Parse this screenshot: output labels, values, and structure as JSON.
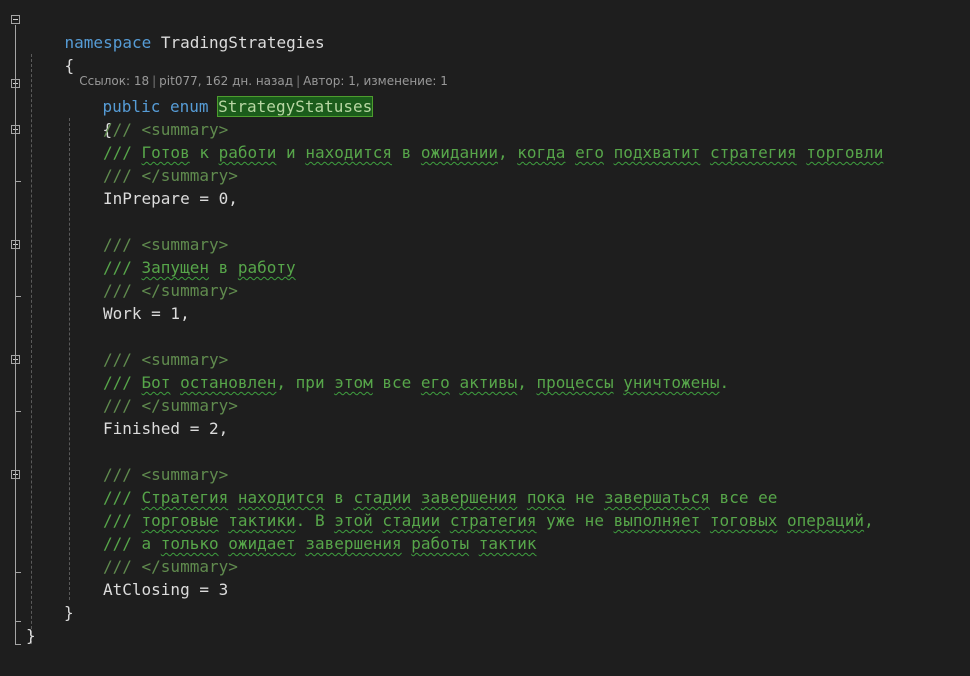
{
  "code": {
    "l1": {
      "kw": "namespace",
      "name": "TradingStrategies"
    },
    "l2": {
      "brace": "{"
    },
    "codelens": {
      "refs": "Ссылок: 18",
      "changed": "pit077, 162 дн. назад",
      "authors": "Автор: 1, изменение: 1"
    },
    "l4": {
      "kw1": "public",
      "kw2": "enum",
      "name": "StrategyStatuses"
    },
    "l5": {
      "brace": "{"
    },
    "m1": {
      "open": "/// <summary>",
      "t": {
        "p": "/// ",
        "a": "Готов",
        "s1": " к ",
        "b": "работи",
        "s2": " и ",
        "c": "находится",
        "s3": " в ",
        "d": "ожидании",
        "s4": ", ",
        "e": "когда",
        "s5": " ",
        "f": "его",
        "s6": " ",
        "g": "подхватит",
        "s7": " ",
        "h": "стратегия",
        "s8": " ",
        "i": "торговли"
      },
      "close": "/// </summary>",
      "code": "InPrepare = 0,"
    },
    "m2": {
      "open": "/// <summary>",
      "t": {
        "p": "/// ",
        "a": "Запущен",
        "s1": " в ",
        "b": "работу"
      },
      "close": "/// </summary>",
      "code": "Work = 1,"
    },
    "m3": {
      "open": "/// <summary>",
      "t": {
        "p": "/// ",
        "a": "Бот",
        "s1": " ",
        "b": "остановлен",
        "s2": ", при ",
        "c": "этом",
        "s3": " все ",
        "d": "его",
        "s4": " ",
        "e": "активы",
        "s5": ", ",
        "f": "процессы",
        "s6": " ",
        "g": "уничтожены",
        "s7": "."
      },
      "close": "/// </summary>",
      "code": "Finished = 2,"
    },
    "m4": {
      "open": "/// <summary>",
      "t1": {
        "p": "/// ",
        "a": "Стратегия",
        "s1": " ",
        "b": "находится",
        "s2": " в ",
        "c": "стадии",
        "s3": " ",
        "d": "завершения",
        "s4": " ",
        "e": "пока",
        "s5": " не ",
        "f": "завершаться",
        "s6": " все ее"
      },
      "t2": {
        "p": "/// ",
        "a": "торговые",
        "s1": " ",
        "b": "тактики",
        "s2": ". В ",
        "c": "этой",
        "s3": " ",
        "d": "стадии",
        "s4": " ",
        "e": "стратегия",
        "s5": " уже не ",
        "f": "выполняет",
        "s6": " ",
        "g": "тоговых",
        "s7": " ",
        "h": "операций",
        "s8": ","
      },
      "t3": {
        "p": "/// а ",
        "a": "только",
        "s1": " ",
        "b": "ожидает",
        "s2": " ",
        "c": "завершения",
        "s3": " ",
        "d": "работы",
        "s4": " ",
        "e": "тактик"
      },
      "close": "/// </summary>",
      "code": "AtClosing = 3"
    },
    "l_close_enum": "}",
    "l_close_ns": "}"
  }
}
